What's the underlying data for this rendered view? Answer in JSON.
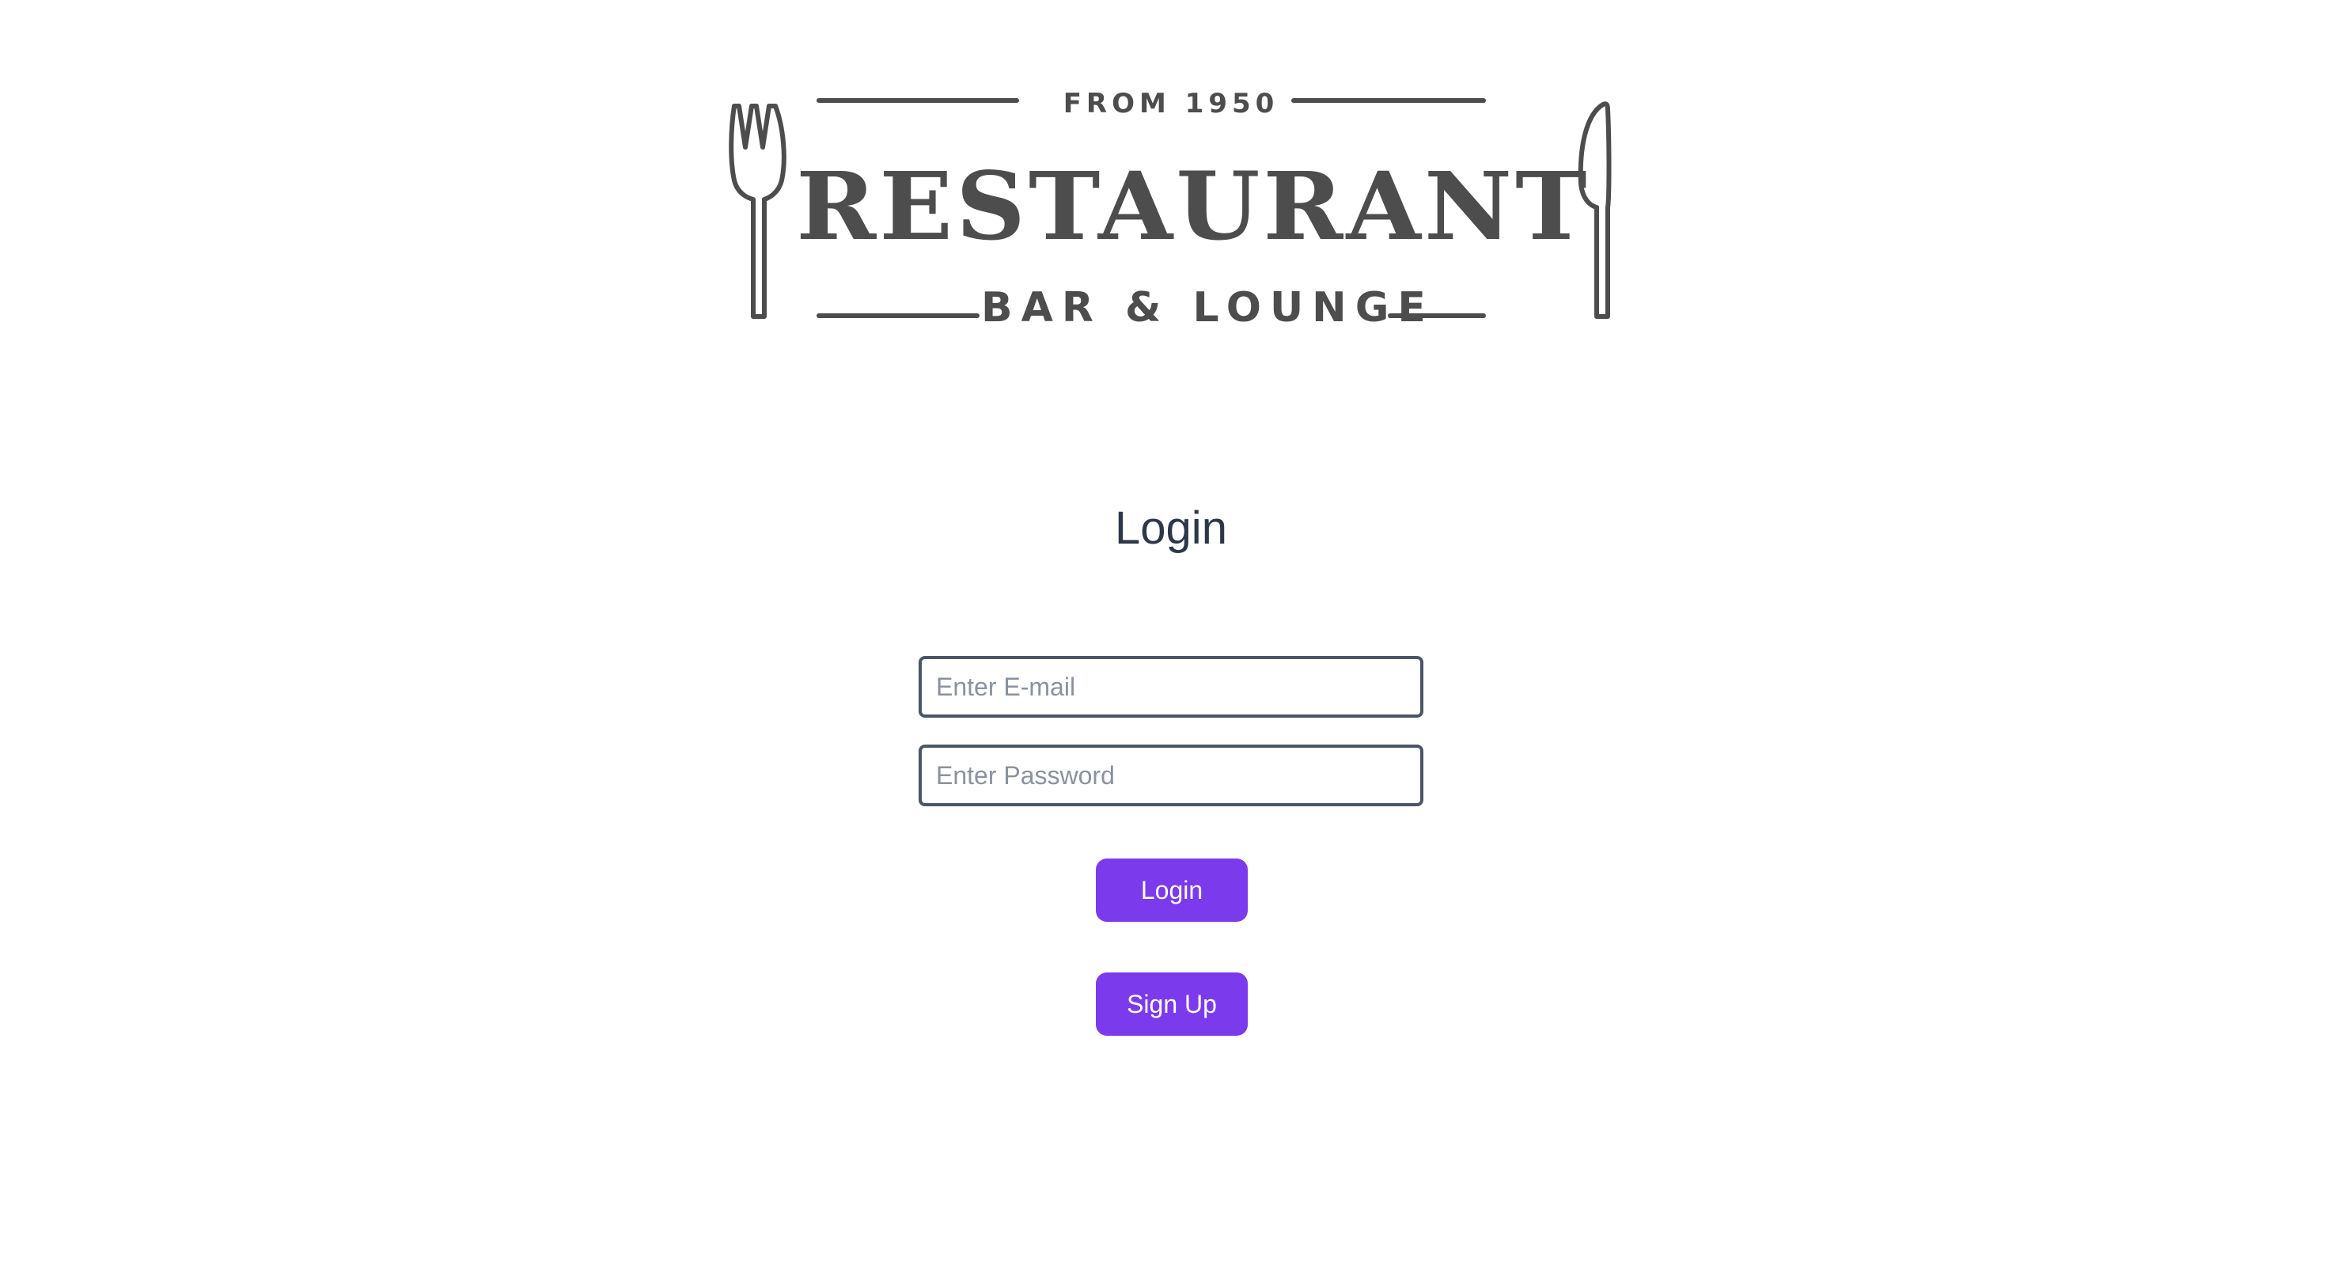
{
  "logo": {
    "top_text": "FROM 1950",
    "main_text": "RESTAURANT",
    "bottom_text": "BAR & LOUNGE",
    "color": "#4d4d4d",
    "icons": [
      "fork-icon",
      "knife-icon"
    ]
  },
  "login": {
    "title": "Login",
    "email_placeholder": "Enter E-mail",
    "email_value": "",
    "password_placeholder": "Enter Password",
    "password_value": "",
    "login_button": "Login",
    "signup_button": "Sign Up"
  },
  "colors": {
    "accent": "#7c3aed",
    "input_border": "#4a5568",
    "title_text": "#2d3748"
  }
}
